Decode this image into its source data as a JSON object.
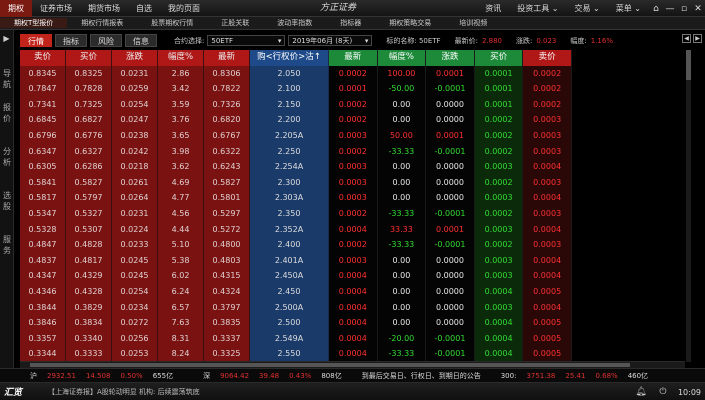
{
  "menu": {
    "items": [
      "期权",
      "证券市场",
      "期货市场",
      "自选",
      "我的页面"
    ],
    "brand": "方正证券",
    "right_items": [
      "资讯",
      "投资工具 ⌄",
      "交易 ⌄",
      "菜单 ⌄"
    ],
    "window_buttons": [
      "⌂",
      "—",
      "▫",
      "✕"
    ]
  },
  "subbar": {
    "items": [
      "期权T型报价",
      "期权行情报表",
      "股票期权行情",
      "正股关联",
      "波动率指数",
      "指标器",
      "期权策略交易",
      "培训视频"
    ]
  },
  "sidenav": {
    "arrow": "▶",
    "items": [
      "导航",
      "报价",
      "分析",
      "选股",
      "服务"
    ]
  },
  "toolbar": {
    "tabs": [
      "行情",
      "指标",
      "风险",
      "信息"
    ],
    "contract_label": "合约选择:",
    "contract_value": "50ETF",
    "expiry_value": "2019年06月 (8天)",
    "underlying_label": "标的名称: 50ETF",
    "last_label": "最新价:",
    "last_value": "2.880",
    "change_label": "涨跌:",
    "change_value": "0.023",
    "pct_label": "幅度:",
    "pct_value": "1.16%",
    "arrows": [
      "◀",
      "▶"
    ]
  },
  "table": {
    "headers": {
      "call": [
        "卖价",
        "买价",
        "涨跌",
        "幅度%",
        "最新"
      ],
      "strike": "购<行权价>沽↑",
      "put": [
        "最新",
        "幅度%",
        "涨跌",
        "买价",
        "卖价"
      ]
    },
    "rows": [
      {
        "call": [
          "0.8345",
          "0.8325",
          "0.0231",
          "2.86",
          "0.8306"
        ],
        "strike": "2.050",
        "put": [
          "0.0002",
          "100.00",
          "0.0001",
          "0.0001",
          "0.0002"
        ]
      },
      {
        "call": [
          "0.7847",
          "0.7828",
          "0.0259",
          "3.42",
          "0.7822"
        ],
        "strike": "2.100",
        "put": [
          "0.0001",
          "-50.00",
          "-0.0001",
          "0.0001",
          "0.0002"
        ]
      },
      {
        "call": [
          "0.7341",
          "0.7325",
          "0.0254",
          "3.59",
          "0.7326"
        ],
        "strike": "2.150",
        "put": [
          "0.0002",
          "0.00",
          "0.0000",
          "0.0001",
          "0.0002"
        ]
      },
      {
        "call": [
          "0.6845",
          "0.6827",
          "0.0247",
          "3.76",
          "0.6820"
        ],
        "strike": "2.200",
        "put": [
          "0.0002",
          "0.00",
          "0.0000",
          "0.0002",
          "0.0003"
        ]
      },
      {
        "call": [
          "0.6796",
          "0.6776",
          "0.0238",
          "3.65",
          "0.6767"
        ],
        "strike": "2.205A",
        "put": [
          "0.0003",
          "50.00",
          "0.0001",
          "0.0002",
          "0.0003"
        ]
      },
      {
        "call": [
          "0.6347",
          "0.6327",
          "0.0242",
          "3.98",
          "0.6322"
        ],
        "strike": "2.250",
        "put": [
          "0.0002",
          "-33.33",
          "-0.0001",
          "0.0002",
          "0.0003"
        ]
      },
      {
        "call": [
          "0.6305",
          "0.6286",
          "0.0218",
          "3.62",
          "0.6243"
        ],
        "strike": "2.254A",
        "put": [
          "0.0003",
          "0.00",
          "0.0000",
          "0.0003",
          "0.0004"
        ]
      },
      {
        "call": [
          "0.5841",
          "0.5827",
          "0.0261",
          "4.69",
          "0.5827"
        ],
        "strike": "2.300",
        "put": [
          "0.0003",
          "0.00",
          "0.0000",
          "0.0002",
          "0.0003"
        ]
      },
      {
        "call": [
          "0.5817",
          "0.5797",
          "0.0264",
          "4.77",
          "0.5801"
        ],
        "strike": "2.303A",
        "put": [
          "0.0003",
          "0.00",
          "0.0000",
          "0.0003",
          "0.0004"
        ]
      },
      {
        "call": [
          "0.5347",
          "0.5327",
          "0.0231",
          "4.56",
          "0.5297"
        ],
        "strike": "2.350",
        "put": [
          "0.0002",
          "-33.33",
          "-0.0001",
          "0.0002",
          "0.0003"
        ]
      },
      {
        "call": [
          "0.5328",
          "0.5307",
          "0.0224",
          "4.44",
          "0.5272"
        ],
        "strike": "2.352A",
        "put": [
          "0.0004",
          "33.33",
          "0.0001",
          "0.0003",
          "0.0004"
        ]
      },
      {
        "call": [
          "0.4847",
          "0.4828",
          "0.0233",
          "5.10",
          "0.4800"
        ],
        "strike": "2.400",
        "put": [
          "0.0002",
          "-33.33",
          "-0.0001",
          "0.0002",
          "0.0003"
        ]
      },
      {
        "call": [
          "0.4837",
          "0.4817",
          "0.0245",
          "5.38",
          "0.4803"
        ],
        "strike": "2.401A",
        "put": [
          "0.0003",
          "0.00",
          "0.0000",
          "0.0003",
          "0.0004"
        ]
      },
      {
        "call": [
          "0.4347",
          "0.4329",
          "0.0245",
          "6.02",
          "0.4315"
        ],
        "strike": "2.450A",
        "put": [
          "0.0004",
          "0.00",
          "0.0000",
          "0.0003",
          "0.0004"
        ]
      },
      {
        "call": [
          "0.4346",
          "0.4328",
          "0.0254",
          "6.24",
          "0.4324"
        ],
        "strike": "2.450",
        "put": [
          "0.0004",
          "0.00",
          "0.0000",
          "0.0004",
          "0.0005"
        ]
      },
      {
        "call": [
          "0.3844",
          "0.3829",
          "0.0234",
          "6.57",
          "0.3797"
        ],
        "strike": "2.500A",
        "put": [
          "0.0004",
          "0.00",
          "0.0000",
          "0.0003",
          "0.0004"
        ]
      },
      {
        "call": [
          "0.3846",
          "0.3834",
          "0.0272",
          "7.63",
          "0.3835"
        ],
        "strike": "2.500",
        "put": [
          "0.0004",
          "0.00",
          "0.0000",
          "0.0004",
          "0.0005"
        ]
      },
      {
        "call": [
          "0.3357",
          "0.3340",
          "0.0256",
          "8.31",
          "0.3337"
        ],
        "strike": "2.549A",
        "put": [
          "0.0004",
          "-20.00",
          "-0.0001",
          "0.0004",
          "0.0005"
        ]
      },
      {
        "call": [
          "0.3344",
          "0.3333",
          "0.0253",
          "8.24",
          "0.3325"
        ],
        "strike": "2.550",
        "put": [
          "0.0004",
          "-33.33",
          "-0.0001",
          "0.0004",
          "0.0005"
        ]
      }
    ]
  },
  "status": {
    "sh_label": "沪",
    "sh_index": "2932.51",
    "sh_change": "14.508",
    "sh_pct": "0.50%",
    "sh_volume": "655亿",
    "sz_label": "深",
    "sz_index": "9064.42",
    "sz_change": "39.48",
    "sz_pct": "0.43%",
    "sz_volume": "808亿",
    "center_text": "到最后交易日、行权日、到期日的公告",
    "cy_label": "300:",
    "cy_index": "3751.38",
    "cy_change": "25.41",
    "cy_pct": "0.68%",
    "cy_volume": "460亿"
  },
  "ticker": {
    "logo": "汇览",
    "text": "【上海证券报】A股轮动明显 机构: 后续震荡筑底",
    "time": "10:09",
    "icons": [
      "bell-icon",
      "power-icon"
    ]
  }
}
